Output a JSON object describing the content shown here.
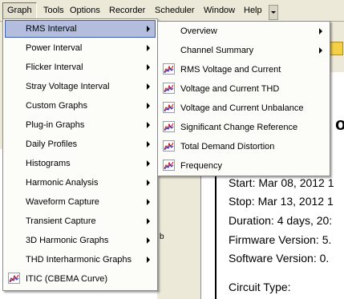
{
  "menubar": {
    "items": [
      "Graph",
      "Tools",
      "Options",
      "Recorder",
      "Scheduler",
      "Window",
      "Help"
    ]
  },
  "graph_menu": {
    "items": [
      {
        "label": "RMS Interval",
        "submenu": true,
        "highlighted": true
      },
      {
        "label": "Power Interval",
        "submenu": true
      },
      {
        "label": "Flicker Interval",
        "submenu": true
      },
      {
        "label": "Stray Voltage Interval",
        "submenu": true
      },
      {
        "label": "Custom Graphs",
        "submenu": true
      },
      {
        "label": "Plug-in Graphs",
        "submenu": true
      },
      {
        "label": "Daily Profiles",
        "submenu": true
      },
      {
        "label": "Histograms",
        "submenu": true
      },
      {
        "label": "Harmonic Analysis",
        "submenu": true
      },
      {
        "label": "Waveform Capture",
        "submenu": true
      },
      {
        "label": "Transient Capture",
        "submenu": true
      },
      {
        "label": "3D Harmonic Graphs",
        "submenu": true
      },
      {
        "label": "THD Interharmonic Graphs",
        "submenu": true
      },
      {
        "label": "ITIC (CBEMA Curve)",
        "icon": "graph-icon"
      }
    ]
  },
  "rms_submenu": {
    "items": [
      {
        "label": "Overview",
        "submenu": true
      },
      {
        "label": "Channel Summary",
        "submenu": true
      },
      {
        "label": "RMS Voltage and Current",
        "icon": "graph-icon"
      },
      {
        "label": "Voltage and Current THD",
        "icon": "graph-icon"
      },
      {
        "label": "Voltage and Current Unbalance",
        "icon": "graph-icon"
      },
      {
        "label": "Significant Change Reference",
        "icon": "graph-icon"
      },
      {
        "label": "Total Demand Distortion",
        "icon": "graph-icon"
      },
      {
        "label": "Frequency",
        "icon": "graph-icon"
      }
    ]
  },
  "report": {
    "heading_fragment": "o",
    "lines": [
      "Start: Mar 08, 2012 1",
      "Stop: Mar 13, 2012 1",
      "Duration: 4 days, 20:",
      "Firmware Version: 5.",
      "Software Version:  0.",
      "Circuit Type:"
    ]
  },
  "left_panel": {
    "fragments": [
      "b"
    ]
  }
}
